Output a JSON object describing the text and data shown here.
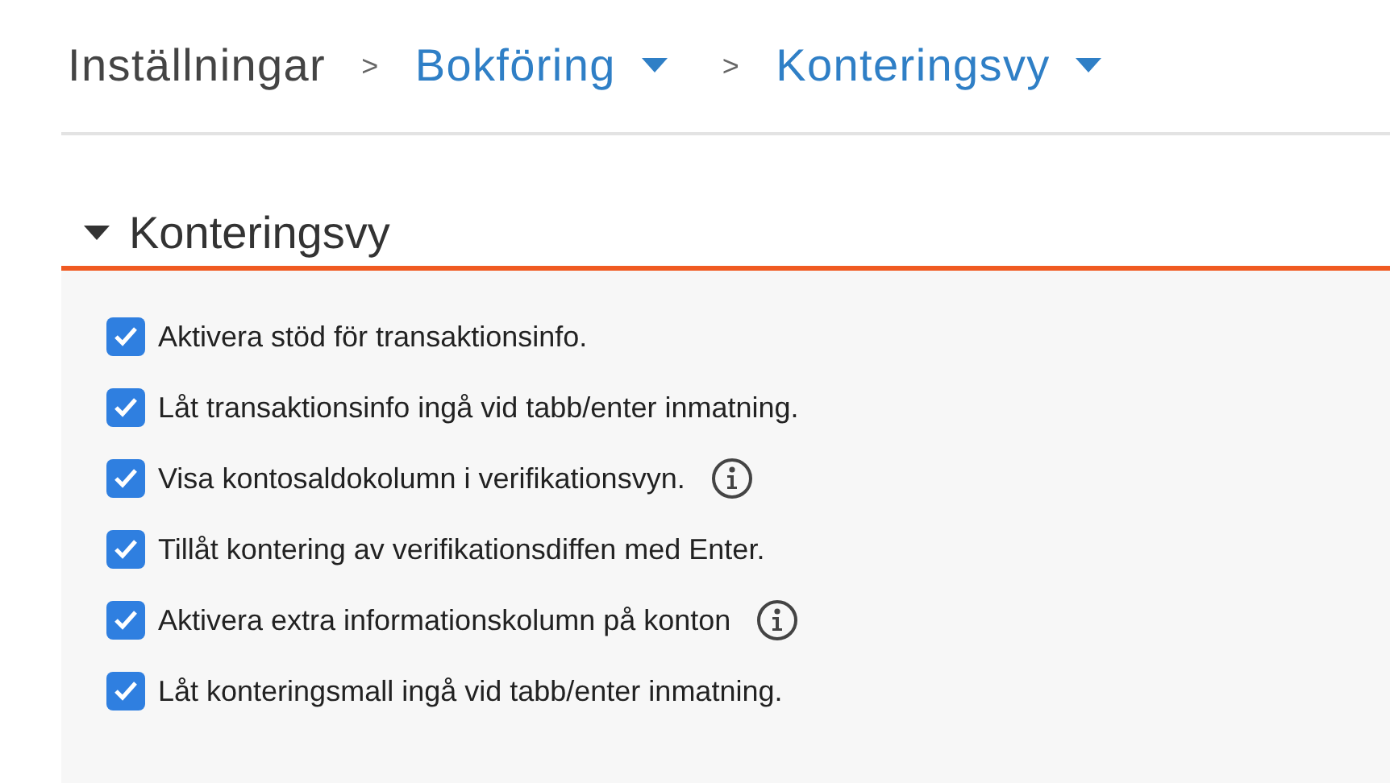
{
  "breadcrumb": [
    {
      "label": "Inställningar",
      "kind": "plain"
    },
    {
      "label": "Bokföring",
      "kind": "dropdown",
      "separator": ">"
    },
    {
      "label": "Konteringsvy",
      "kind": "dropdown",
      "separator": ">"
    }
  ],
  "section": {
    "title": "Konteringsvy",
    "expanded": true,
    "options": [
      {
        "label": "Aktivera stöd för transaktionsinfo.",
        "checked": true,
        "info": false
      },
      {
        "label": "Låt transaktionsinfo ingå vid tabb/enter inmatning.",
        "checked": true,
        "info": false
      },
      {
        "label": "Visa kontosaldokolumn i verifikationsvyn.",
        "checked": true,
        "info": true
      },
      {
        "label": "Tillåt kontering av verifikationsdiffen med Enter.",
        "checked": true,
        "info": false
      },
      {
        "label": "Aktivera extra informationskolumn på konton",
        "checked": true,
        "info": true
      },
      {
        "label": "Låt konteringsmall ingå vid tabb/enter inmatning.",
        "checked": true,
        "info": false
      }
    ]
  }
}
